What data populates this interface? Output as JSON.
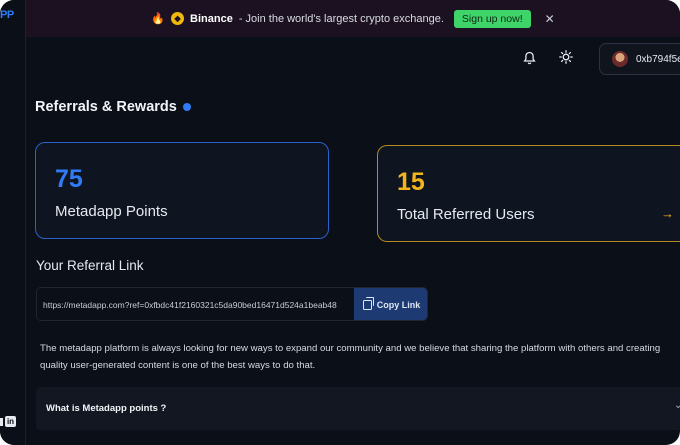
{
  "brand": {
    "logo_text": "PP"
  },
  "banner": {
    "fire_icon": "🔥",
    "coin_icon": "binance-coin-icon",
    "name": "Binance",
    "message": "- Join the world's largest crypto exchange.",
    "signup_label": "Sign up now!",
    "close_glyph": "✕"
  },
  "header": {
    "bell_icon": "bell-icon",
    "theme_icon": "sun-icon",
    "wallet_address": "0xb794f5e"
  },
  "page": {
    "title": "Referrals & Rewards"
  },
  "stats": {
    "points_value": "75",
    "points_label": "Metadapp Points",
    "referred_value": "15",
    "referred_label": "Total Referred Users",
    "arrow_glyph": "→"
  },
  "referral": {
    "section_label": "Your Referral Link",
    "link": "https://metadapp.com?ref=0xfbdc41f2160321c5da90bed16471d524a1beab48",
    "copy_label": "Copy Link"
  },
  "description": {
    "line1": "The metadapp platform is always looking for new ways to expand our community and we believe that  sharing the platform with others and creating",
    "line2": "quality user-generated content is one of the best ways to do that."
  },
  "faq": {
    "question": "What is Metadapp points ?",
    "chevron": "⌄"
  },
  "footer": {
    "linkedin_label": "in"
  },
  "colors": {
    "accent_blue": "#2f7cf6",
    "accent_gold": "#f3b51c",
    "signup_green": "#3fd46a"
  }
}
